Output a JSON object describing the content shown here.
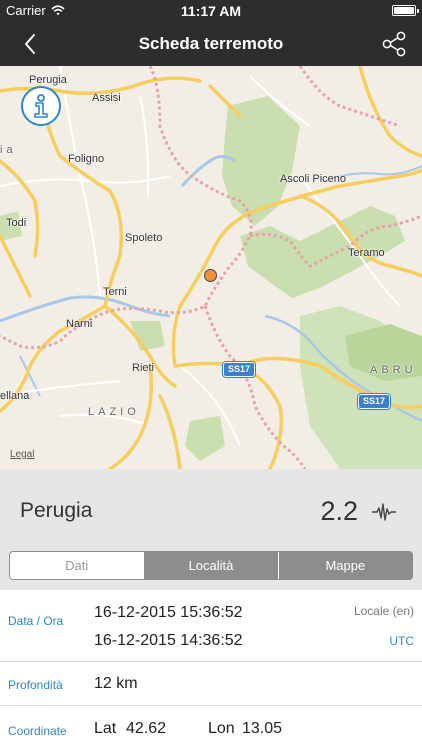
{
  "status_bar": {
    "carrier": "Carrier",
    "time": "11:17 AM",
    "battery_level": 1.0
  },
  "nav": {
    "title": "Scheda terremoto"
  },
  "map": {
    "labels": {
      "perugia": "Perugia",
      "assisi": "Assisi",
      "foligno": "Foligno",
      "todi": "Todi",
      "spoleto": "Spoleto",
      "terni": "Terni",
      "narni": "Narni",
      "rieti": "Rieti",
      "ascoli": "Ascoli Piceno",
      "teramo": "Teramo",
      "lazio": "LAZIO",
      "abru": "ABRU",
      "ellana": "ellana",
      "orvieto_partial": "ia",
      "legal": "Legal"
    },
    "road_shields": [
      "SS17",
      "SS17"
    ]
  },
  "summary": {
    "place": "Perugia",
    "magnitude": "2.2"
  },
  "tabs": [
    {
      "label": "Dati",
      "active": true
    },
    {
      "label": "Località",
      "active": false
    },
    {
      "label": "Mappe",
      "active": false
    }
  ],
  "details": {
    "datetime_label": "Data / Ora",
    "local_datetime": "16-12-2015 15:36:52",
    "local_tag": "Locale (en)",
    "utc_datetime": "16-12-2015 14:36:52",
    "utc_tag": "UTC",
    "depth_label": "Profondità",
    "depth_value": "12 km",
    "coords_label": "Coordinate",
    "lat_label": "Lat",
    "lat_value": "42.62",
    "lon_label": "Lon",
    "lon_value": "13.05"
  },
  "colors": {
    "accent": "#2f87c7",
    "bar": "#2d2d2d",
    "quake": "#f2913c",
    "park": "#c9dfb0",
    "road": "#f7cd5e"
  }
}
